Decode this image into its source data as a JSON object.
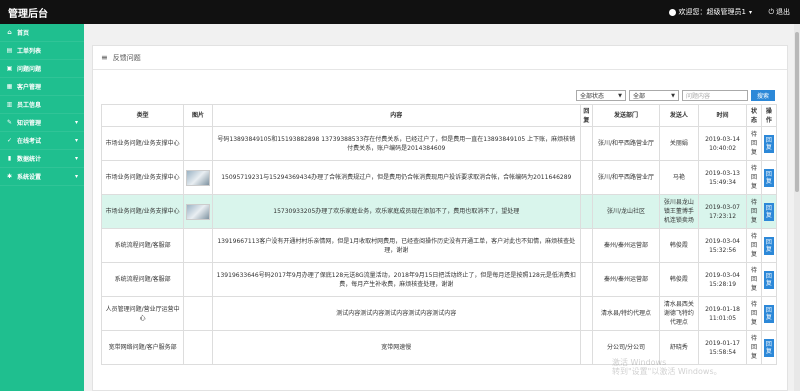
{
  "topbar": {
    "title": "管理后台",
    "user_label": "欢迎您：超级管理员1",
    "logout_label": "退出"
  },
  "sidebar": {
    "items": [
      {
        "label": "首页",
        "icon": "home-icon",
        "has_children": false
      },
      {
        "label": "工单列表",
        "icon": "list-icon",
        "has_children": false
      },
      {
        "label": "问题问题",
        "icon": "question-icon",
        "has_children": false
      },
      {
        "label": "客户管理",
        "icon": "users-icon",
        "has_children": false
      },
      {
        "label": "员工信息",
        "icon": "user-icon",
        "has_children": false
      },
      {
        "label": "知识管理",
        "icon": "book-icon",
        "has_children": true
      },
      {
        "label": "在线考试",
        "icon": "exam-icon",
        "has_children": true
      },
      {
        "label": "数据统计",
        "icon": "chart-icon",
        "has_children": true
      },
      {
        "label": "系统设置",
        "icon": "gear-icon",
        "has_children": true
      }
    ]
  },
  "panel": {
    "title": "反馈问题"
  },
  "filters": {
    "status": "全部状态",
    "type": "全部",
    "search_placeholder": "问题内容",
    "search_label": "搜索"
  },
  "table": {
    "headers": [
      "类型",
      "图片",
      "内容",
      "回复",
      "发送部门",
      "发送人",
      "时间",
      "状态",
      "操作"
    ],
    "rows": [
      {
        "type": "市场业务问题/业务支撑中心",
        "has_image": false,
        "content": "号码13893849105和15193882898 13739388533存在付费关系，已经过户了，但是费用一直在13893849105 上下账，麻烦核销付费关系，账户编码是2014384609",
        "reply": "",
        "dept": "张川/和平西路营业厅",
        "sender": "关丽娟",
        "time": "2019-03-14 10:40:02",
        "status": "待回复",
        "action": "回复"
      },
      {
        "type": "市场业务问题/业务支撑中心",
        "has_image": true,
        "content": "15095719231与15294369434办理了合帐消费规过户，但是费用仍合帐消费现用户投诉要求取消合帐，合帐编码为2011646289",
        "reply": "",
        "dept": "张川/和平西路营业厅",
        "sender": "马艳",
        "time": "2019-03-13 15:49:34",
        "status": "待回复",
        "action": "回复"
      },
      {
        "type": "市场业务问题/业务支撑中心",
        "has_image": true,
        "content": "15730933205办理了欢乐家庭业务，欢乐家庭成员现在添加不了，费用也取消不了，望处理",
        "reply": "",
        "dept": "张川/龙山社区",
        "sender": "张川县龙山镇王董博手机连锁卖场",
        "time": "2019-03-07 17:23:12",
        "status": "待回复",
        "action": "回复",
        "highlight": true
      },
      {
        "type": "系统流程问题/客服部",
        "has_image": false,
        "content": "13919667113客户没有开通村村乐亲情网，但是1月收取村网费用，已经查阅操作历史没有开通工单，客户对此也不知情，麻烦核查处理，谢谢",
        "reply": "",
        "dept": "秦州/秦州运营部",
        "sender": "韩俊霞",
        "time": "2019-03-04 15:32:56",
        "status": "待回复",
        "action": "回复"
      },
      {
        "type": "系统流程问题/客服部",
        "has_image": false,
        "content": "13919633646号码2017年9月办理了保底128元送8G流量活动，2018年9月15日把活动终止了，但是每月还是按照128元是低消费扣费，每月产生补收费，麻烦核查处理，谢谢",
        "reply": "",
        "dept": "秦州/秦州运营部",
        "sender": "韩俊霞",
        "time": "2019-03-04 15:28:19",
        "status": "待回复",
        "action": "回复"
      },
      {
        "type": "人员管理问题/营业厅运营中心",
        "has_image": false,
        "content": "测试内容测试内容测试内容测试内容测试内容",
        "reply": "",
        "dept": "清水县/特约代理点",
        "sender": "清水县西关谢德飞特约代理点",
        "time": "2019-01-18 11:01:05",
        "status": "待回复",
        "action": "回复"
      },
      {
        "type": "宽带网络问题/客户服务部",
        "has_image": false,
        "content": "宽带网速慢",
        "reply": "",
        "dept": "分公司/分公司",
        "sender": "舒晓秀",
        "time": "2019-01-17 15:58:54",
        "status": "待回复",
        "action": "回复"
      }
    ]
  },
  "watermark": {
    "line1": "激活 Windows",
    "line2": "转到\"设置\"以激活 Windows。"
  }
}
